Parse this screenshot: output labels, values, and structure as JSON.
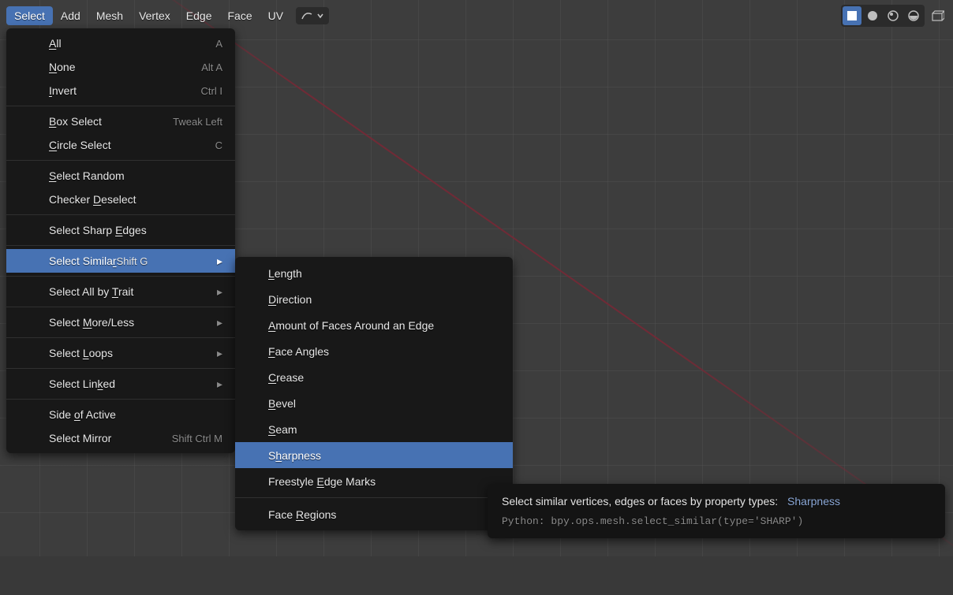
{
  "menubar": {
    "items": [
      {
        "label": "Select",
        "active": true
      },
      {
        "label": "Add"
      },
      {
        "label": "Mesh"
      },
      {
        "label": "Vertex"
      },
      {
        "label": "Edge"
      },
      {
        "label": "Face"
      },
      {
        "label": "UV"
      }
    ],
    "shading": [
      "solid",
      "matcap",
      "material",
      "rendered"
    ],
    "shading_active": 0
  },
  "menu": {
    "groups": [
      [
        {
          "label_pre": "",
          "ul": "A",
          "label_post": "ll",
          "shortcut": "A"
        },
        {
          "label_pre": "",
          "ul": "N",
          "label_post": "one",
          "shortcut": "Alt A"
        },
        {
          "label_pre": "",
          "ul": "I",
          "label_post": "nvert",
          "shortcut": "Ctrl I"
        }
      ],
      [
        {
          "label_pre": "",
          "ul": "B",
          "label_post": "ox Select",
          "shortcut": "Tweak Left"
        },
        {
          "label_pre": "",
          "ul": "C",
          "label_post": "ircle Select",
          "shortcut": "C"
        }
      ],
      [
        {
          "label_pre": "",
          "ul": "S",
          "label_post": "elect Random"
        },
        {
          "label_pre": "Checker ",
          "ul": "D",
          "label_post": "eselect"
        }
      ],
      [
        {
          "label_pre": "Select Sharp ",
          "ul": "E",
          "label_post": "dges"
        }
      ],
      [
        {
          "label_pre": "Select Simila",
          "ul": "r",
          "label_post": "",
          "shortcut": "Shift G",
          "submenu": true,
          "highlight": true
        }
      ],
      [
        {
          "label_pre": "Select All by ",
          "ul": "T",
          "label_post": "rait",
          "submenu": true
        }
      ],
      [
        {
          "label_pre": "Select ",
          "ul": "M",
          "label_post": "ore/Less",
          "submenu": true
        }
      ],
      [
        {
          "label_pre": "Select ",
          "ul": "L",
          "label_post": "oops",
          "submenu": true
        }
      ],
      [
        {
          "label_pre": "Select Lin",
          "ul": "k",
          "label_post": "ed",
          "submenu": true
        }
      ],
      [
        {
          "label_pre": "Side ",
          "ul": "o",
          "label_post": "f Active"
        },
        {
          "label_pre": "Select Mirror",
          "ul": "",
          "label_post": "",
          "shortcut": "Shift Ctrl M"
        }
      ]
    ]
  },
  "submenu": {
    "groups": [
      [
        {
          "label_pre": "",
          "ul": "L",
          "label_post": "ength"
        },
        {
          "label_pre": "",
          "ul": "D",
          "label_post": "irection"
        },
        {
          "label_pre": "",
          "ul": "A",
          "label_post": "mount of Faces Around an Edge"
        },
        {
          "label_pre": "",
          "ul": "F",
          "label_post": "ace Angles"
        },
        {
          "label_pre": "",
          "ul": "C",
          "label_post": "rease"
        },
        {
          "label_pre": "",
          "ul": "B",
          "label_post": "evel"
        },
        {
          "label_pre": "",
          "ul": "S",
          "label_post": "eam"
        },
        {
          "label_pre": "S",
          "ul": "h",
          "label_post": "arpness",
          "highlight": true
        },
        {
          "label_pre": "Freestyle ",
          "ul": "E",
          "label_post": "dge Marks"
        }
      ],
      [
        {
          "label_pre": "Face ",
          "ul": "R",
          "label_post": "egions"
        }
      ]
    ]
  },
  "tooltip": {
    "desc": "Select similar vertices, edges or faces by property types:",
    "target": "Sharpness",
    "python": "Python: bpy.ops.mesh.select_similar(type='SHARP')"
  }
}
